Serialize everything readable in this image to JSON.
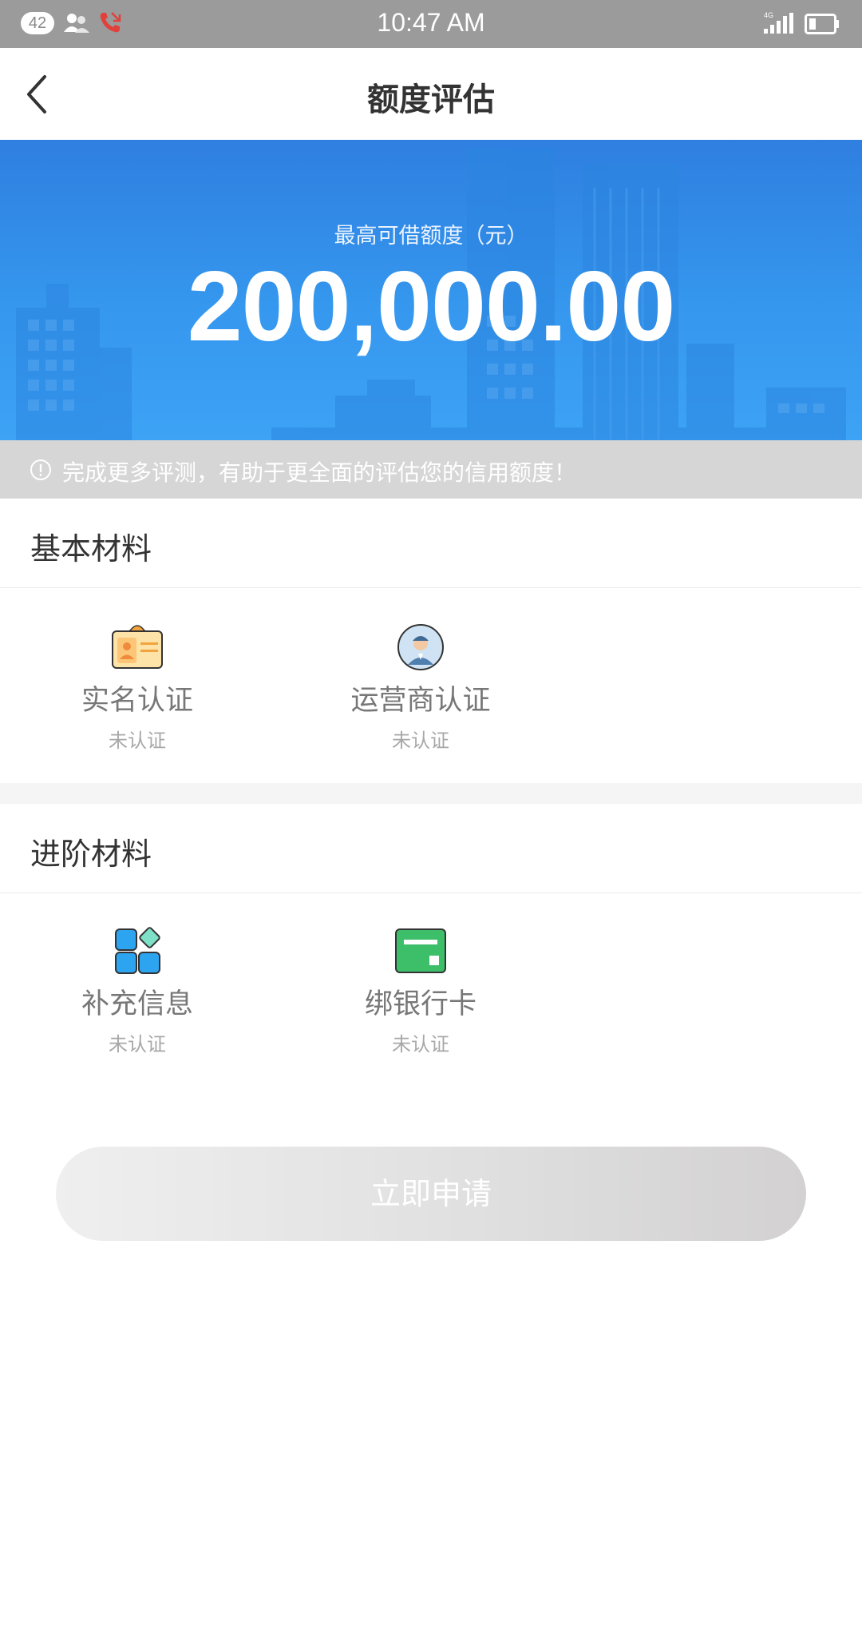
{
  "status_bar": {
    "notification_count": "42",
    "time": "10:47 AM",
    "network": "4G",
    "icons": [
      "contacts-icon",
      "missed-call-icon",
      "signal-icon",
      "battery-icon"
    ]
  },
  "header": {
    "title": "额度评估",
    "back_icon": "chevron-left-icon"
  },
  "hero": {
    "label": "最高可借额度（元）",
    "amount": "200,000.00"
  },
  "notice": {
    "text": "完成更多评测，有助于更全面的评估您的信用额度！",
    "icon": "info-circle-icon"
  },
  "sections": [
    {
      "title": "基本材料",
      "items": [
        {
          "label": "实名认证",
          "status": "未认证",
          "icon": "id-card-icon"
        },
        {
          "label": "运营商认证",
          "status": "未认证",
          "icon": "operator-avatar-icon"
        }
      ]
    },
    {
      "title": "进阶材料",
      "items": [
        {
          "label": "补充信息",
          "status": "未认证",
          "icon": "apps-grid-icon"
        },
        {
          "label": "绑银行卡",
          "status": "未认证",
          "icon": "bank-card-icon"
        }
      ]
    }
  ],
  "actions": {
    "apply_label": "立即申请"
  },
  "colors": {
    "hero_blue": "#3597ee",
    "notice_gray": "#d6d6d6",
    "button_gray": "#e0e0e0",
    "card_green": "#3dbf6a",
    "tile_blue": "#2da4f0"
  }
}
